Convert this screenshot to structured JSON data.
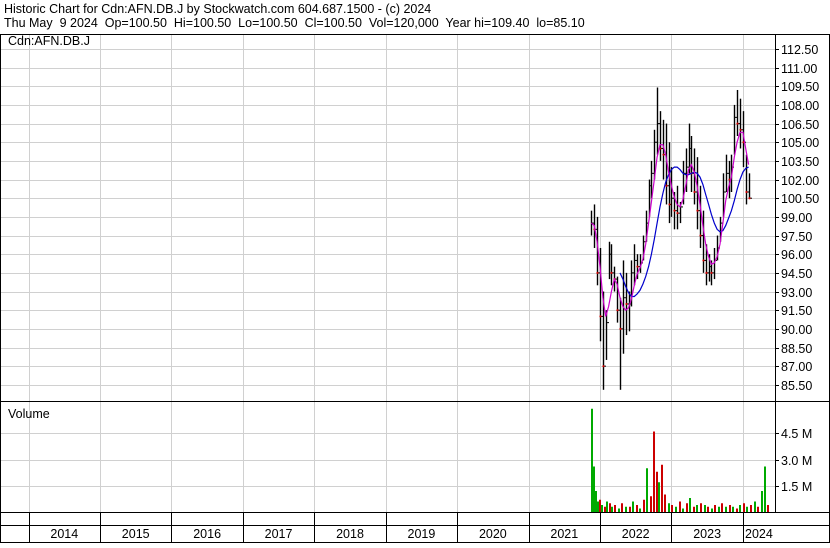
{
  "header": {
    "line1": "Historic Chart for Cdn:AFN.DB.J by Stockwatch.com 604.687.1500 - (c) 2024",
    "line2": "Thu May  9 2024  Op=100.50  Hi=100.50  Lo=100.50  Cl=100.50  Vol=120,000  Year hi=109.40  lo=85.10"
  },
  "chart_data": [
    {
      "type": "line",
      "title": "Cdn:AFN.DB.J",
      "subtype": "OHLC price bars with two moving averages",
      "x_labels": [
        "2014",
        "2015",
        "2016",
        "2017",
        "2018",
        "2019",
        "2020",
        "2021",
        "2022",
        "2023",
        "2024"
      ],
      "xlim": [
        2013.6,
        2024.45
      ],
      "y_ticks": [
        "112.50",
        "111.00",
        "109.50",
        "108.00",
        "106.50",
        "105.00",
        "103.50",
        "102.00",
        "100.50",
        "99.00",
        "97.50",
        "96.00",
        "94.50",
        "93.00",
        "91.50",
        "90.00",
        "88.50",
        "87.00",
        "85.50"
      ],
      "ylim": [
        84.2,
        113.7
      ],
      "grid": true,
      "colors": {
        "price": "#000000",
        "ma_short": "#cc00cc",
        "ma_long": "#0000cc",
        "down_tick": "#cc0000"
      },
      "series": [
        {
          "x": [
            2021.88,
            2021.92,
            2021.96,
            2022.0,
            2022.04,
            2022.08,
            2022.12,
            2022.16,
            2022.2,
            2022.24,
            2022.28,
            2022.32,
            2022.36,
            2022.4,
            2022.44,
            2022.48,
            2022.52,
            2022.56,
            2022.6,
            2022.64,
            2022.68,
            2022.72,
            2022.76,
            2022.8,
            2022.84,
            2022.88,
            2022.92,
            2022.96,
            2023.0,
            2023.04,
            2023.08,
            2023.12,
            2023.16,
            2023.2,
            2023.24,
            2023.28,
            2023.32,
            2023.36,
            2023.4,
            2023.44,
            2023.48,
            2023.52,
            2023.56,
            2023.6,
            2023.64,
            2023.68,
            2023.72,
            2023.76,
            2023.8,
            2023.84,
            2023.88,
            2023.92,
            2023.96,
            2024.0,
            2024.04,
            2024.08,
            2024.12,
            2024.16,
            2024.2,
            2024.24,
            2024.28,
            2024.32
          ],
          "high": [
            99.5,
            100.0,
            99.0,
            96.5,
            93.0,
            91.5,
            97.0,
            96.8,
            95.0,
            94.2,
            92.5,
            95.5,
            94.5,
            93.0,
            95.5,
            96.8,
            96.0,
            96.0,
            97.5,
            99.5,
            102.0,
            103.5,
            106.0,
            109.4,
            107.5,
            106.8,
            106.5,
            105.0,
            103.0,
            101.0,
            101.5,
            100.2,
            103.5,
            104.5,
            106.5,
            105.5,
            104.5,
            103.8,
            101.5,
            99.5,
            96.8,
            96.0,
            95.5,
            96.5,
            97.5,
            99.0,
            102.5,
            104.0,
            103.5,
            104.0,
            108.0,
            109.2,
            108.5,
            107.5,
            104.0,
            102.5
          ],
          "low": [
            97.5,
            96.5,
            93.5,
            89.0,
            85.1,
            87.5,
            94.0,
            93.5,
            93.0,
            90.5,
            85.1,
            88.0,
            89.5,
            89.8,
            91.8,
            93.5,
            94.0,
            94.5,
            95.5,
            97.0,
            99.0,
            100.5,
            102.0,
            104.0,
            103.5,
            102.0,
            100.0,
            98.5,
            99.0,
            98.0,
            98.0,
            98.5,
            100.0,
            101.0,
            102.5,
            101.0,
            100.0,
            98.0,
            96.5,
            94.5,
            93.5,
            93.8,
            93.5,
            94.0,
            95.5,
            97.0,
            99.0,
            101.0,
            100.5,
            101.0,
            104.0,
            105.5,
            104.5,
            103.0,
            100.0,
            100.5
          ],
          "close": [
            98.5,
            98.0,
            94.5,
            91.0,
            87.0,
            90.5,
            96.0,
            94.5,
            94.0,
            91.5,
            90.0,
            92.5,
            92.0,
            92.0,
            94.5,
            95.5,
            95.0,
            95.3,
            97.0,
            98.5,
            101.5,
            102.5,
            105.0,
            106.5,
            104.5,
            104.0,
            101.5,
            100.0,
            100.5,
            99.5,
            99.3,
            99.8,
            102.5,
            103.0,
            104.5,
            102.5,
            101.0,
            99.5,
            97.5,
            95.5,
            94.5,
            95.0,
            94.5,
            95.5,
            96.5,
            98.5,
            101.0,
            102.5,
            102.0,
            103.0,
            107.0,
            106.5,
            106.0,
            105.0,
            101.0,
            100.5
          ],
          "ma_short": [
            98.5,
            98.3,
            97.0,
            95.0,
            92.5,
            91.0,
            91.8,
            93.0,
            94.0,
            93.6,
            92.5,
            91.8,
            91.5,
            91.7,
            92.4,
            93.5,
            94.4,
            94.9,
            95.6,
            96.8,
            98.5,
            100.2,
            102.0,
            103.8,
            104.8,
            104.8,
            104.0,
            102.6,
            101.5,
            100.6,
            100.0,
            99.8,
            100.4,
            101.5,
            102.8,
            103.2,
            102.6,
            101.5,
            100.0,
            98.3,
            96.8,
            95.8,
            95.2,
            95.3,
            95.8,
            96.8,
            98.5,
            100.3,
            101.4,
            102.2,
            103.8,
            105.0,
            105.8,
            105.8,
            104.5,
            103.2
          ],
          "ma_long": [
            null,
            null,
            null,
            null,
            null,
            null,
            null,
            null,
            null,
            null,
            94.5,
            94.0,
            93.4,
            92.9,
            92.6,
            92.6,
            92.8,
            93.1,
            93.6,
            94.2,
            95.0,
            96.0,
            97.2,
            98.5,
            99.8,
            100.9,
            101.8,
            102.4,
            102.8,
            103.0,
            103.0,
            102.8,
            102.5,
            102.4,
            102.4,
            102.5,
            102.6,
            102.5,
            102.2,
            101.6,
            100.8,
            100.0,
            99.2,
            98.5,
            98.0,
            97.8,
            97.9,
            98.3,
            98.9,
            99.5,
            100.3,
            101.2,
            102.0,
            102.6,
            102.9,
            103.0
          ]
        }
      ]
    },
    {
      "type": "bar",
      "title": "Volume",
      "y_ticks": [
        "4.5 M",
        "3.0 M",
        "1.5 M"
      ],
      "ylim": [
        0,
        6.0
      ],
      "unit": "M",
      "colors": {
        "up": "#00aa00",
        "down": "#cc0000"
      },
      "x": [
        2021.88,
        2021.9,
        2021.93,
        2021.96,
        2021.99,
        2022.02,
        2022.05,
        2022.08,
        2022.12,
        2022.16,
        2022.2,
        2022.25,
        2022.3,
        2022.35,
        2022.4,
        2022.45,
        2022.5,
        2022.55,
        2022.6,
        2022.65,
        2022.7,
        2022.74,
        2022.78,
        2022.81,
        2022.85,
        2022.9,
        2022.95,
        2023.0,
        2023.05,
        2023.1,
        2023.15,
        2023.2,
        2023.25,
        2023.3,
        2023.35,
        2023.4,
        2023.45,
        2023.5,
        2023.55,
        2023.6,
        2023.65,
        2023.7,
        2023.75,
        2023.8,
        2023.85,
        2023.9,
        2023.95,
        2024.0,
        2024.05,
        2024.1,
        2024.15,
        2024.2,
        2024.25,
        2024.3,
        2024.34
      ],
      "values": [
        5.9,
        2.6,
        1.2,
        0.6,
        0.7,
        0.4,
        0.3,
        0.6,
        0.5,
        0.3,
        0.4,
        0.2,
        0.5,
        0.3,
        0.3,
        0.6,
        0.4,
        0.2,
        0.7,
        2.5,
        0.9,
        4.6,
        2.3,
        1.7,
        2.7,
        1.0,
        0.5,
        0.4,
        0.3,
        0.6,
        0.2,
        0.5,
        0.8,
        0.3,
        0.4,
        0.5,
        0.4,
        0.3,
        0.2,
        0.4,
        0.3,
        0.5,
        0.3,
        0.4,
        0.3,
        0.2,
        0.4,
        0.5,
        0.3,
        0.4,
        0.6,
        0.3,
        1.2,
        2.6,
        0.4
      ],
      "direction": [
        "up",
        "up",
        "up",
        "up",
        "down",
        "up",
        "down",
        "up",
        "down",
        "up",
        "down",
        "up",
        "down",
        "up",
        "down",
        "up",
        "down",
        "up",
        "down",
        "up",
        "down",
        "down",
        "down",
        "up",
        "down",
        "down",
        "up",
        "down",
        "up",
        "down",
        "up",
        "down",
        "up",
        "down",
        "up",
        "down",
        "up",
        "down",
        "up",
        "down",
        "up",
        "down",
        "up",
        "down",
        "up",
        "down",
        "up",
        "down",
        "up",
        "down",
        "up",
        "down",
        "up",
        "up",
        "down"
      ]
    }
  ]
}
